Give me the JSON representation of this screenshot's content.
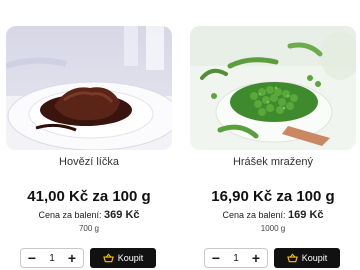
{
  "products": [
    {
      "name": "Hovězí líčka",
      "price": "41,00 Kč za 100 g",
      "pack_label": "Cena za balení:",
      "pack_price": "369 Kč",
      "weight": "700 g",
      "quantity": "1",
      "minus": "−",
      "plus": "+",
      "buy_label": "Koupit",
      "image_icon": "beef-cheeks-photo",
      "cart_icon": "basket-icon"
    },
    {
      "name": "Hrášek mražený",
      "price": "16,90 Kč za 100 g",
      "pack_label": "Cena za balení:",
      "pack_price": "169 Kč",
      "weight": "1000 g",
      "quantity": "1",
      "minus": "−",
      "plus": "+",
      "buy_label": "Koupit",
      "image_icon": "frozen-peas-photo",
      "cart_icon": "basket-icon"
    }
  ],
  "colors": {
    "accent": "#f2c40f",
    "button_bg": "#111111"
  }
}
